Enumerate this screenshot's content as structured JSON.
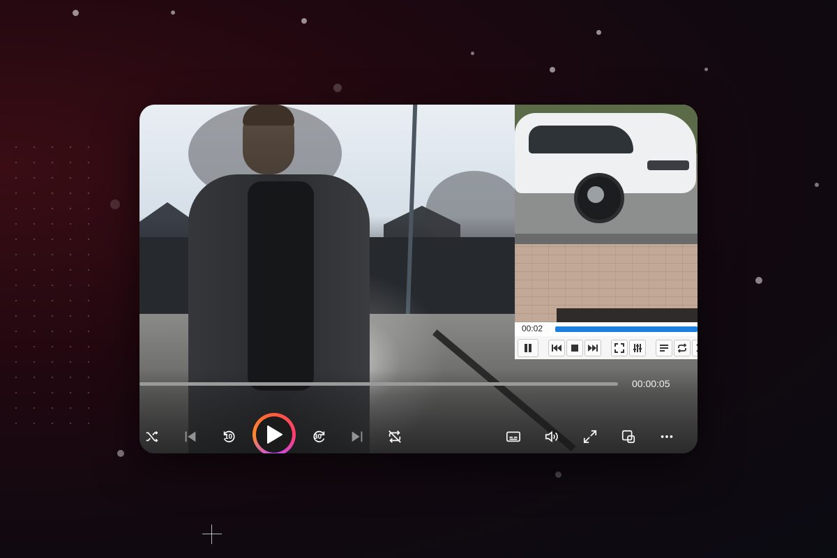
{
  "player": {
    "time_elapsed": "00:00:05",
    "progress_fraction": 0.0
  },
  "mini_player": {
    "time": "00:02",
    "progress_fraction": 1.0
  },
  "controls": {
    "skip_back_seconds": "10",
    "skip_forward_seconds": "30"
  },
  "icons": [
    "shuffle-icon",
    "previous-icon",
    "rewind-10-icon",
    "play-icon",
    "forward-30-icon",
    "next-icon",
    "repeat-icon",
    "subtitles-icon",
    "volume-icon",
    "fullscreen-icon",
    "mini-player-icon",
    "more-icon"
  ],
  "colors": {
    "accent_ring_start": "#ff5a3c",
    "accent_ring_end": "#c04cff",
    "mini_player_progress": "#1d7fe0"
  }
}
